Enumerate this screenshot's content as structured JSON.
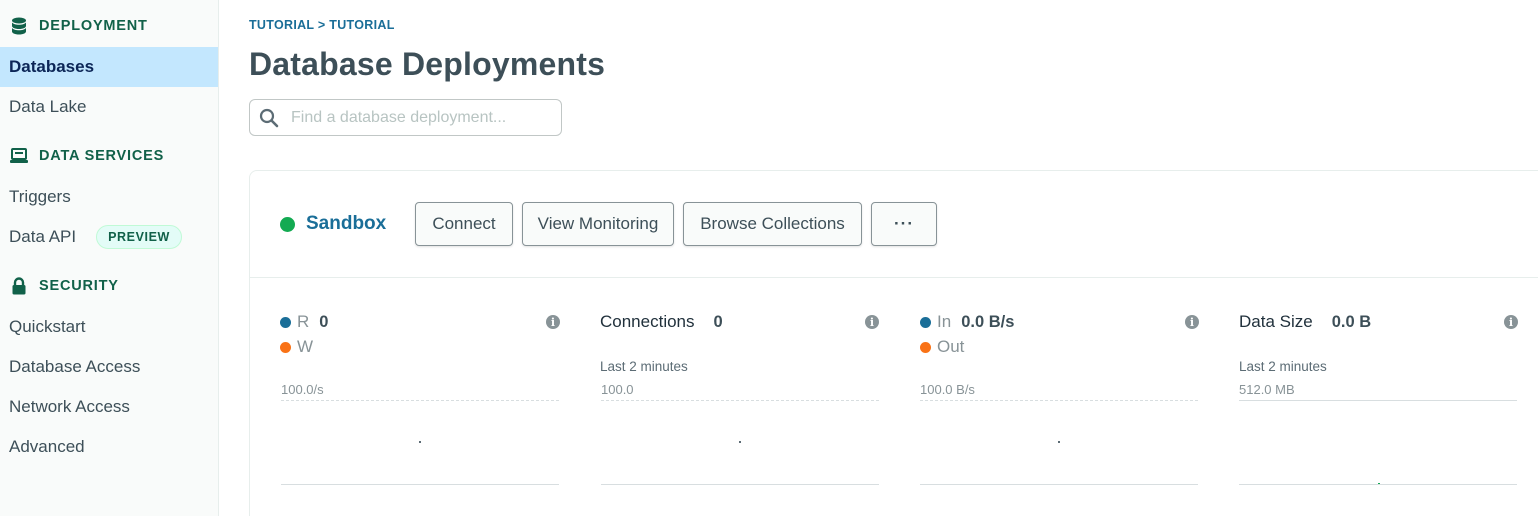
{
  "sidebar": {
    "sections": [
      {
        "title": "DEPLOYMENT",
        "icon": "database-icon"
      },
      {
        "title": "DATA SERVICES",
        "icon": "laptop-icon"
      },
      {
        "title": "SECURITY",
        "icon": "lock-icon"
      }
    ],
    "items": [
      {
        "label": "Databases",
        "active": true
      },
      {
        "label": "Data Lake"
      },
      {
        "label": "Triggers"
      },
      {
        "label": "Data API",
        "badge": "PREVIEW"
      },
      {
        "label": "Quickstart"
      },
      {
        "label": "Database Access"
      },
      {
        "label": "Network Access"
      },
      {
        "label": "Advanced"
      }
    ]
  },
  "breadcrumb": {
    "org": "TUTORIAL",
    "separator": " > ",
    "project": "TUTORIAL"
  },
  "page_title": "Database Deployments",
  "search": {
    "placeholder": "Find a database deployment..."
  },
  "cluster": {
    "name": "Sandbox",
    "status_color": "#13aa52",
    "buttons": {
      "connect": "Connect",
      "view_monitoring": "View Monitoring",
      "browse_collections": "Browse Collections",
      "more": "···"
    }
  },
  "metrics": {
    "ops": {
      "read_label": "R",
      "read_value": "0",
      "write_label": "W",
      "scale": "100.0/s",
      "read_color": "#1a6e98",
      "write_color": "#f97216"
    },
    "connections": {
      "title": "Connections",
      "value": "0",
      "subtitle": "Last 2 minutes",
      "scale": "100.0"
    },
    "network": {
      "in_label": "In",
      "in_value": "0.0 B/s",
      "out_label": "Out",
      "scale": "100.0 B/s",
      "in_color": "#1a6e98",
      "out_color": "#f97216"
    },
    "data_size": {
      "title": "Data Size",
      "value": "0.0 B",
      "subtitle": "Last 2 minutes",
      "scale": "512.0 MB"
    }
  },
  "colors": {
    "accent": "#1a6e98",
    "sidebar_active": "#c3e7fe",
    "section_heading": "#116149"
  }
}
